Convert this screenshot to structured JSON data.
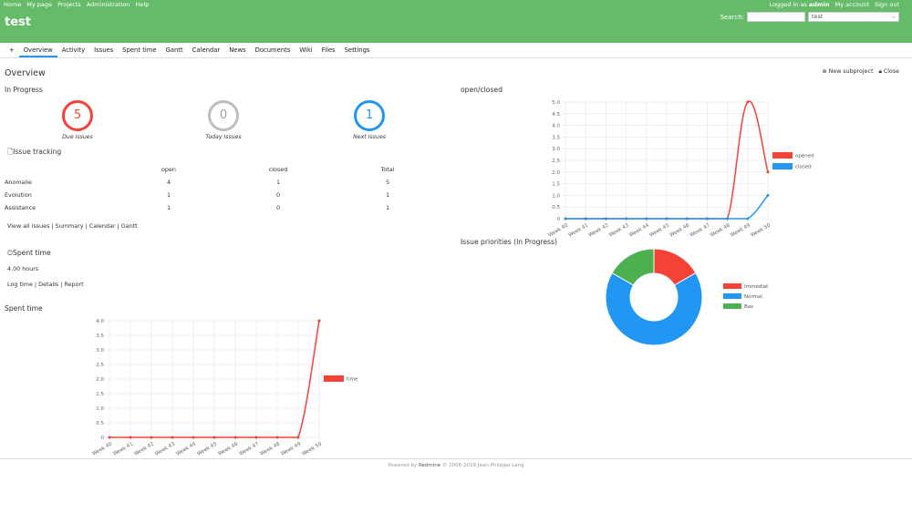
{
  "header": {
    "top_menu": [
      "Home",
      "My page",
      "Projects",
      "Administration",
      "Help"
    ],
    "logged_in_prefix": "Logged in as",
    "user": "admin",
    "account_links": [
      "My account",
      "Sign out"
    ],
    "project_title": "test",
    "search_label": "Search:",
    "project_select": "test"
  },
  "tabs": [
    "+",
    "Overview",
    "Activity",
    "Issues",
    "Spent time",
    "Gantt",
    "Calendar",
    "News",
    "Documents",
    "Wiki",
    "Files",
    "Settings"
  ],
  "page": {
    "title": "Overview",
    "new_subproject": "New subproject",
    "close": "Close"
  },
  "in_progress": {
    "title": "In Progress",
    "circles": [
      {
        "value": "5",
        "label": "Due Issues",
        "color": "#f44336"
      },
      {
        "value": "0",
        "label": "Today Issues",
        "color": "#bdbdbd"
      },
      {
        "value": "1",
        "label": "Next Issues",
        "color": "#2196f3"
      }
    ]
  },
  "issue_tracking": {
    "title": "Issue tracking",
    "headers": [
      "",
      "open",
      "closed",
      "Total"
    ],
    "rows": [
      [
        "Anomalie",
        "4",
        "1",
        "5"
      ],
      [
        "Evolution",
        "1",
        "0",
        "1"
      ],
      [
        "Assistance",
        "1",
        "0",
        "1"
      ]
    ],
    "links": "View all issues | Summary | Calendar | Gantt"
  },
  "spent_time_box": {
    "title": "Spent time",
    "hours": "4.00 hours",
    "links": "Log time | Details | Report"
  },
  "footer": {
    "prefix": "Powered by",
    "brand": "Redmine",
    "suffix": "© 2006-2019 Jean-Philippe Lang"
  },
  "chart_data": [
    {
      "type": "line",
      "title": "open/closed",
      "x": [
        "Week 40",
        "Week 41",
        "Week 42",
        "Week 43",
        "Week 44",
        "Week 45",
        "Week 46",
        "Week 47",
        "Week 48",
        "Week 49",
        "Week 50"
      ],
      "ylim": [
        0,
        5
      ],
      "yticks": [
        "0",
        "0.5",
        "1.0",
        "1.5",
        "2.0",
        "2.5",
        "3.0",
        "3.5",
        "4.0",
        "4.5",
        "5.0"
      ],
      "series": [
        {
          "name": "opened",
          "color": "#f44336",
          "values": [
            0,
            0,
            0,
            0,
            0,
            0,
            0,
            0,
            0,
            5,
            2
          ]
        },
        {
          "name": "closed",
          "color": "#2196f3",
          "values": [
            0,
            0,
            0,
            0,
            0,
            0,
            0,
            0,
            0,
            0,
            1
          ]
        }
      ],
      "legend": "right"
    },
    {
      "type": "line",
      "title": "Spent time",
      "x": [
        "Week 40",
        "Week 41",
        "Week 42",
        "Week 43",
        "Week 44",
        "Week 45",
        "Week 46",
        "Week 47",
        "Week 48",
        "Week 49",
        "Week 50"
      ],
      "ylim": [
        0,
        4
      ],
      "yticks": [
        "0",
        "0.5",
        "1.0",
        "1.5",
        "2.0",
        "2.5",
        "3.0",
        "3.5",
        "4.0"
      ],
      "series": [
        {
          "name": "time",
          "color": "#f44336",
          "values": [
            0,
            0,
            0,
            0,
            0,
            0,
            0,
            0,
            0,
            0,
            4
          ]
        }
      ],
      "legend": "right"
    },
    {
      "type": "pie",
      "title": "Issue priorities (In Progress)",
      "series": [
        {
          "name": "Immédiat",
          "color": "#f44336",
          "value": 1
        },
        {
          "name": "Normal",
          "color": "#2196f3",
          "value": 4
        },
        {
          "name": "Bas",
          "color": "#4caf50",
          "value": 1
        }
      ],
      "legend": "right"
    }
  ]
}
